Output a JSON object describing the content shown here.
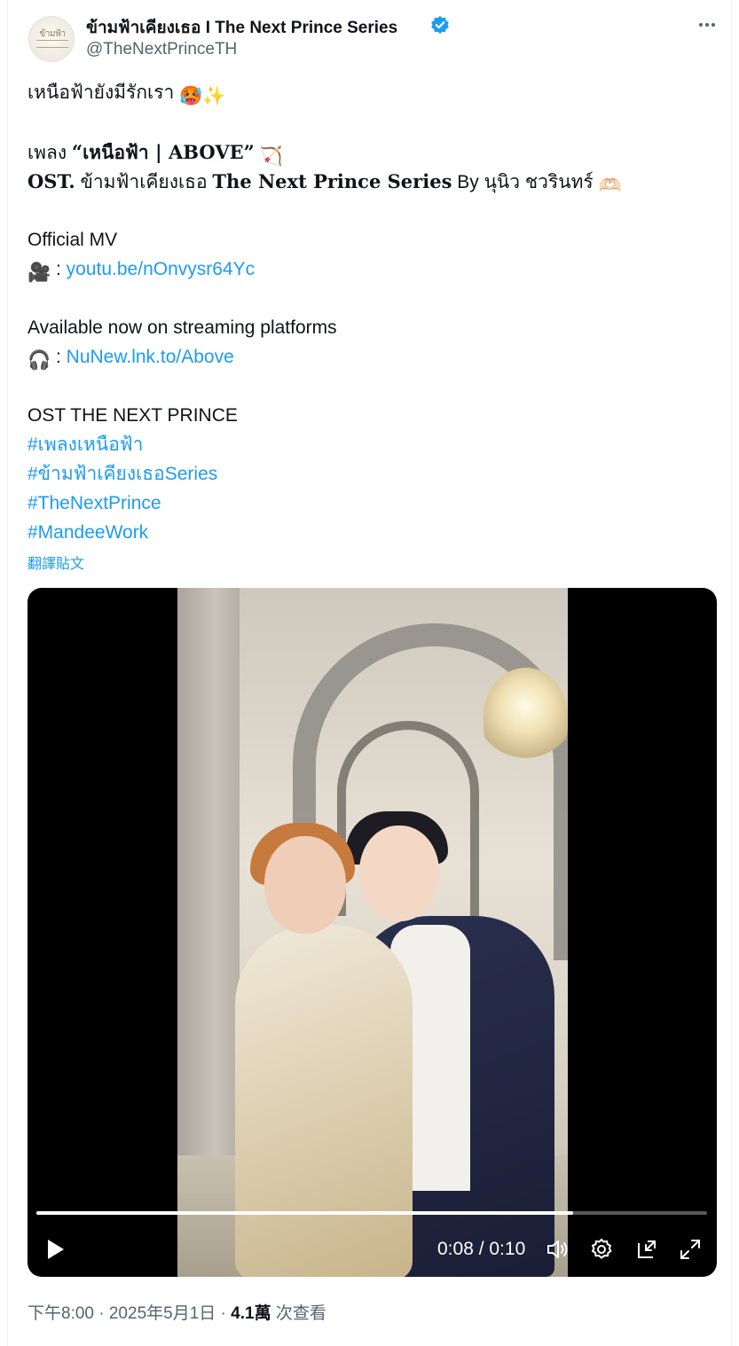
{
  "author": {
    "display_name": "ข้ามฟ้าเคียงเธอ I The Next Prince Series",
    "handle": "@TheNextPrinceTH",
    "avatar_text": "ข้ามฟ้า",
    "verified_color": "#1d9bf0"
  },
  "tweet": {
    "line1": "เหนือฟ้ายังมีรักเรา",
    "line1_emoji": "🥵✨",
    "line2_prefix": "เพลง ",
    "line2_title": "“เหนือฟ้า | ABOVE”",
    "line2_emoji": "🏹",
    "line3_ost": "OST.",
    "line3_mid": " ข้ามฟ้าเคียงเธอ ",
    "line3_series": "The Next Prince Series",
    "line3_by": " By นุนิว ชวรินทร์ ",
    "line3_emoji": "🫶🏻",
    "mv_label": "Official MV",
    "mv_icon": "🎥",
    "mv_sep": " : ",
    "mv_link": "youtu.be/nOnvysr64Yc",
    "stream_label": "Available now on streaming platforms",
    "stream_icon": "🎧",
    "stream_sep": " : ",
    "stream_link": "NuNew.lnk.to/Above",
    "ost_label": "OST THE NEXT PRINCE",
    "hashtags": [
      "#เพลงเหนือฟ้า",
      "#ข้ามฟ้าเคียงเธอSeries",
      "#TheNextPrince",
      "#MandeeWork"
    ],
    "translate": "翻譯貼文"
  },
  "video": {
    "time_text": "0:08 / 0:10",
    "progress": 0.8
  },
  "meta": {
    "time": "下午8:00 · 2025年5月1日 · ",
    "views": "4.1萬",
    "views_label": " 次查看"
  }
}
